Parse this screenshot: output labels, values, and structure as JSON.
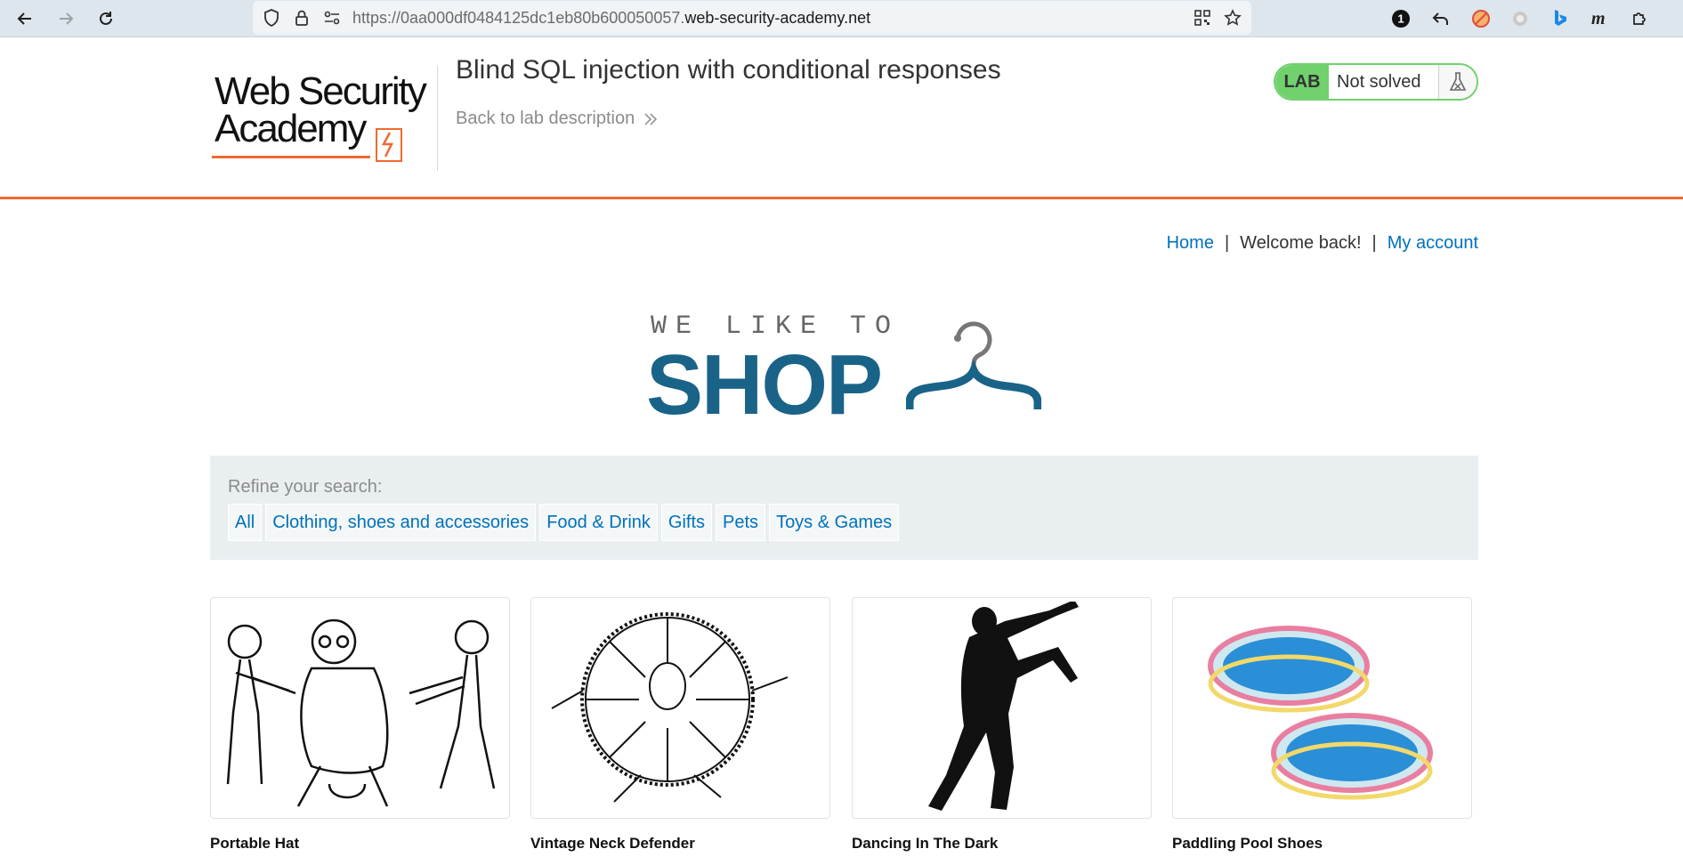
{
  "browser": {
    "url_prefix": "https://0aa000df0484125dc1eb80b600050057.",
    "url_host": "web-security-academy.net",
    "ext_badge": "1"
  },
  "lab": {
    "logo_line1": "Web Security",
    "logo_line2": "Academy",
    "title": "Blind SQL injection with conditional responses",
    "back_link": "Back to lab description",
    "badge": "LAB",
    "status": "Not solved"
  },
  "nav": {
    "home": "Home",
    "sep1": "|",
    "welcome": "Welcome back!",
    "sep2": "|",
    "account": "My account"
  },
  "shop_logo": {
    "tagline": "WE LIKE TO",
    "word": "SHOP"
  },
  "filter": {
    "label": "Refine your search:",
    "items": [
      "All",
      "Clothing, shoes and accessories",
      "Food & Drink",
      "Gifts",
      "Pets",
      "Toys & Games"
    ]
  },
  "products": [
    {
      "name": "Portable Hat",
      "icon": "cartoon-tug-of-war-image"
    },
    {
      "name": "Vintage Neck Defender",
      "icon": "cartoon-neck-ruff-image"
    },
    {
      "name": "Dancing In The Dark",
      "icon": "dancing-silhouette-image"
    },
    {
      "name": "Paddling Pool Shoes",
      "icon": "paddling-pools-image"
    }
  ],
  "colors": {
    "accent": "#ee6a31",
    "link": "#0071bc",
    "shop_blue": "#1a6388",
    "lab_green": "#70d16d"
  }
}
